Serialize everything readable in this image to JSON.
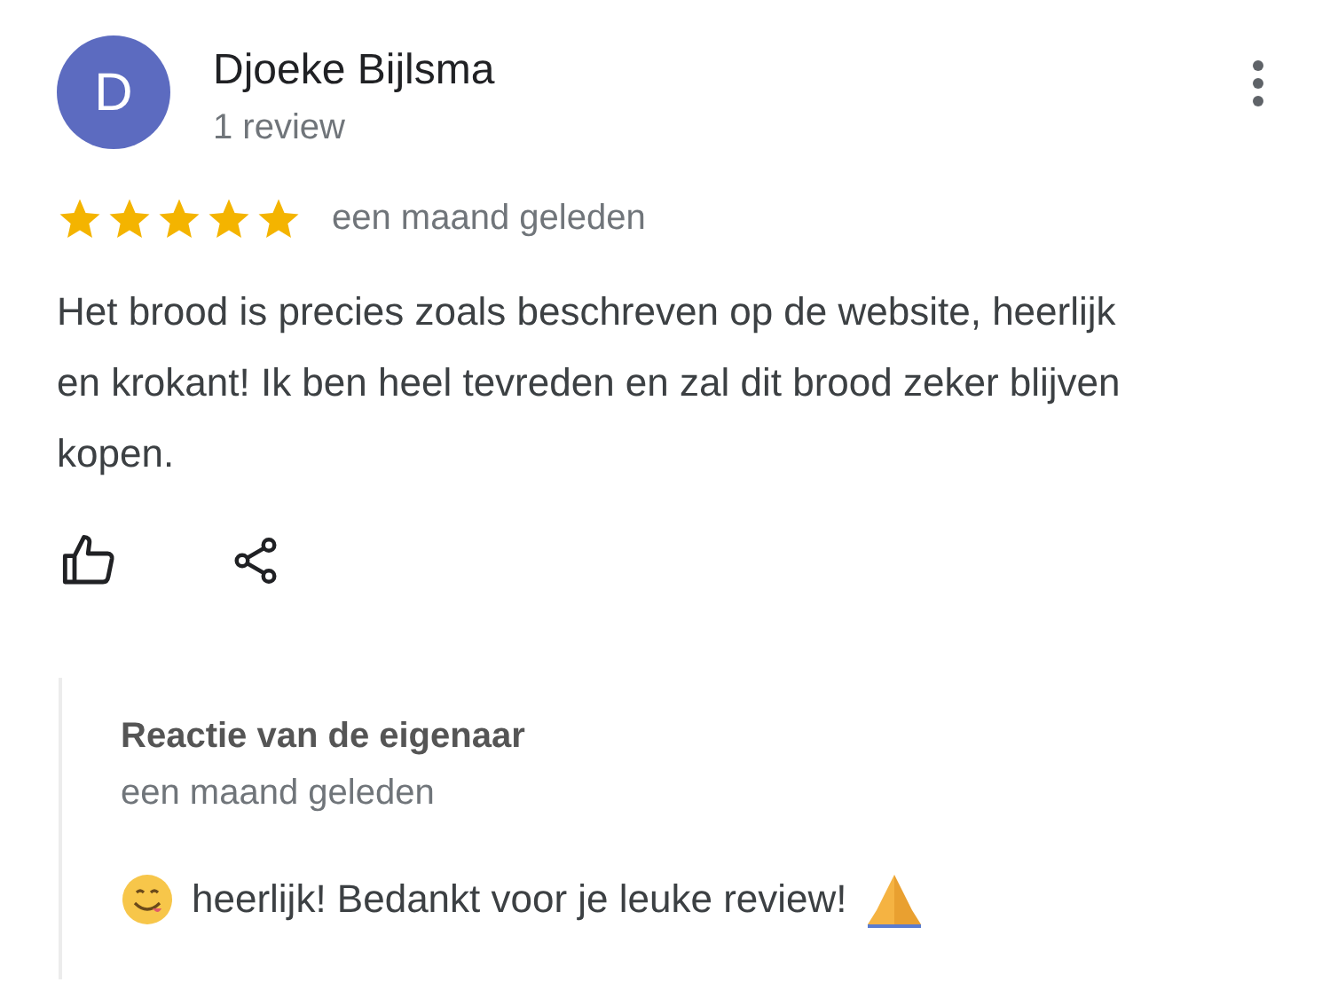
{
  "reviewer": {
    "initial": "D",
    "name": "Djoeke Bijlsma",
    "review_count": "1 review"
  },
  "rating": {
    "stars": 5,
    "time": "een maand geleden"
  },
  "text": "Het brood is precies zoals beschreven op de website, heerlijk en krokant! Ik ben heel tevreden en zal dit brood zeker blijven kopen.",
  "owner_reply": {
    "title": "Reactie van de eigenaar",
    "time": "een maand geleden",
    "text": "heerlijk! Bedankt voor je leuke review!"
  }
}
